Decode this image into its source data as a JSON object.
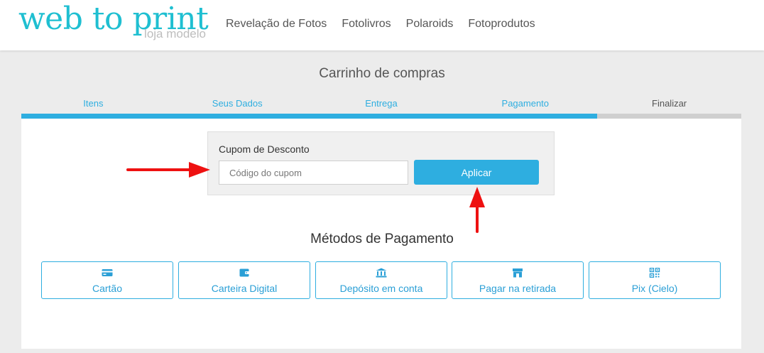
{
  "logo": {
    "main": "web to print",
    "sub": "loja modelo"
  },
  "nav": [
    {
      "label": "Revelação de Fotos"
    },
    {
      "label": "Fotolivros"
    },
    {
      "label": "Polaroids"
    },
    {
      "label": "Fotoprodutos"
    }
  ],
  "cart": {
    "title": "Carrinho de compras"
  },
  "steps": [
    {
      "label": "Itens"
    },
    {
      "label": "Seus Dados"
    },
    {
      "label": "Entrega"
    },
    {
      "label": "Pagamento"
    },
    {
      "label": "Finalizar"
    }
  ],
  "progress": {
    "completed_fraction": 0.8
  },
  "coupon": {
    "label": "Cupom de Desconto",
    "value": "",
    "placeholder": "Código do cupom",
    "apply_label": "Aplicar"
  },
  "payment": {
    "title": "Métodos de Pagamento",
    "methods": [
      {
        "label": "Cartão",
        "icon": "credit-card-icon"
      },
      {
        "label": "Carteira Digital",
        "icon": "wallet-icon"
      },
      {
        "label": "Depósito em conta",
        "icon": "bank-icon"
      },
      {
        "label": "Pagar na retirada",
        "icon": "store-icon"
      },
      {
        "label": "Pix (Cielo)",
        "icon": "qr-code-icon"
      }
    ]
  },
  "colors": {
    "brand": "#1fbfd1",
    "accent": "#2eaee0",
    "annotation_arrow": "#ee1111"
  }
}
